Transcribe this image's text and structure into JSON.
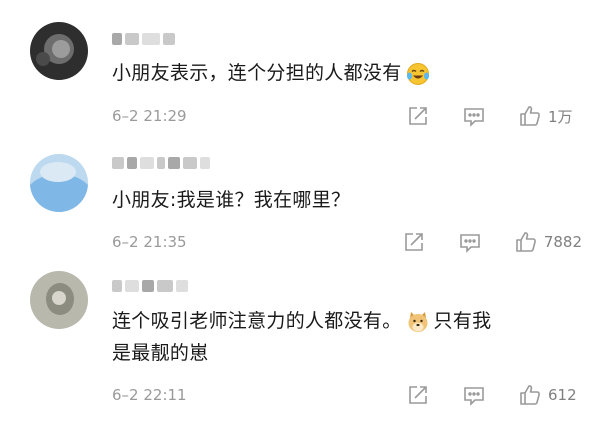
{
  "comments": [
    {
      "text": "小朋友表示，连个分担的人都没有",
      "emoji": "crying-laughing-emoji",
      "time": "6–2 21:29",
      "likes": "1万"
    },
    {
      "text": "小朋友:我是谁？我在哪里？",
      "time": "6–2 21:35",
      "likes": "7882"
    },
    {
      "text_line1": "连个吸引老师注意力的人都没有。",
      "emoji": "doge-emoji",
      "text_line1_tail": "只有我",
      "text_line2": "是最靓的崽",
      "time": "6–2 22:11",
      "likes": "612"
    }
  ],
  "icons": {
    "share": "share-icon",
    "reply": "reply-icon",
    "like": "thumbs-up-icon"
  },
  "colors": {
    "text": "#1a1a1a",
    "meta": "#9a9a9a",
    "icon": "#9a9a9a"
  }
}
